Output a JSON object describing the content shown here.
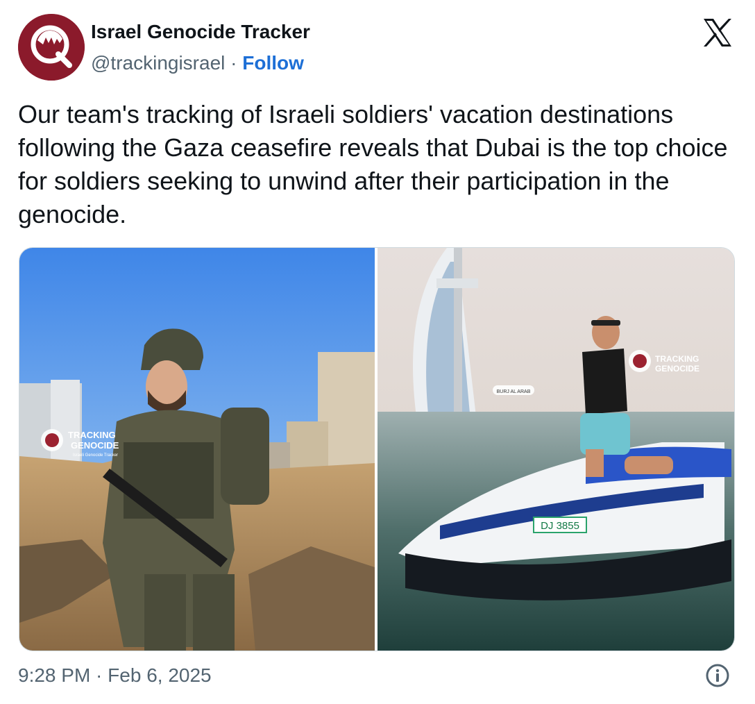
{
  "tweet": {
    "author_name": "Israel Genocide Tracker",
    "handle": "@trackingisrael",
    "separator": " · ",
    "follow_label": "Follow",
    "text": "Our team's tracking of Israeli soldiers' vacation destinations following the Gaza ceasefire reveals that Dubai is the top choice for soldiers seeking to unwind after their participation in the genocide.",
    "time": "9:28 PM",
    "date": "Feb 6, 2025",
    "timestamp_separator": " · "
  },
  "media": {
    "left_image": {
      "watermark_line1": "TRACKING",
      "watermark_line2": "GENOCIDE",
      "watermark_line3": "Israeli Genocide Tracker"
    },
    "right_image": {
      "watermark_line1": "TRACKING",
      "watermark_line2": "GENOCIDE",
      "location_tag": "BURJ AL ARAB",
      "plate": "DJ 3855"
    }
  },
  "icons": {
    "brand": "x-logo-icon",
    "info": "info-icon",
    "avatar_logo": "q-logo-icon"
  },
  "colors": {
    "link": "#1d6fd6",
    "avatar_bg": "#8b1a2b",
    "muted_text": "#536471"
  }
}
